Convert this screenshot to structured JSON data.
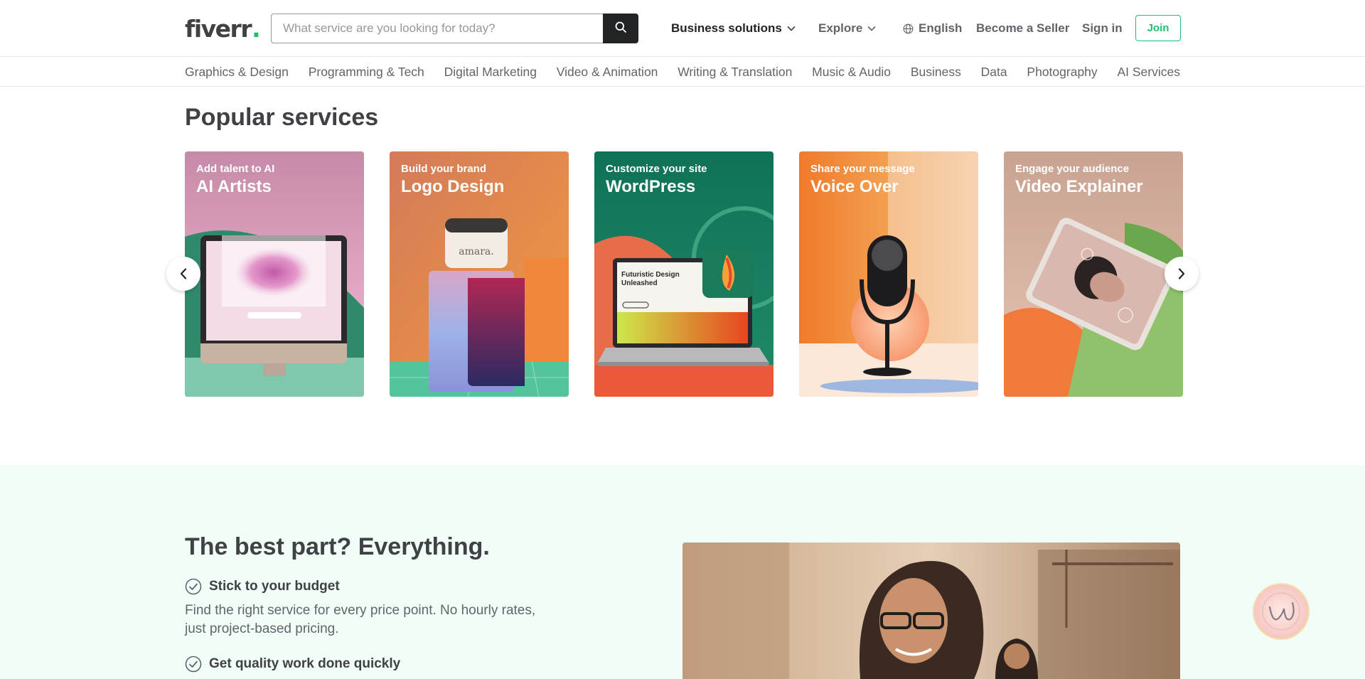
{
  "header": {
    "logo_text": "fiverr",
    "logo_dot": ".",
    "search_placeholder": "What service are you looking for today?",
    "business_solutions": "Business solutions",
    "explore": "Explore",
    "language": "English",
    "become_seller": "Become a Seller",
    "sign_in": "Sign in",
    "join": "Join"
  },
  "categories": [
    "Graphics & Design",
    "Programming & Tech",
    "Digital Marketing",
    "Video & Animation",
    "Writing & Translation",
    "Music & Audio",
    "Business",
    "Data",
    "Photography",
    "AI Services"
  ],
  "popular": {
    "title": "Popular services",
    "cards": [
      {
        "sub": "Add talent to AI",
        "name": "AI Artists"
      },
      {
        "sub": "Build your brand",
        "name": "Logo Design"
      },
      {
        "sub": "Customize your site",
        "name": "WordPress"
      },
      {
        "sub": "Share your message",
        "name": "Voice Over"
      },
      {
        "sub": "Engage your audience",
        "name": "Video Explainer"
      }
    ],
    "logo_jar_text": "amara.",
    "laptop_text_line1": "Futuristic Design",
    "laptop_text_line2": "Unleashed"
  },
  "best": {
    "title": "The best part? Everything.",
    "features": [
      {
        "heading": "Stick to your budget",
        "desc": "Find the right service for every price point. No hourly rates, just project-based pricing."
      },
      {
        "heading": "Get quality work done quickly",
        "desc": ""
      }
    ]
  },
  "colors": {
    "brand_green": "#1dbf73",
    "text_dark": "#404145",
    "section_bg": "#f1fdf7"
  }
}
